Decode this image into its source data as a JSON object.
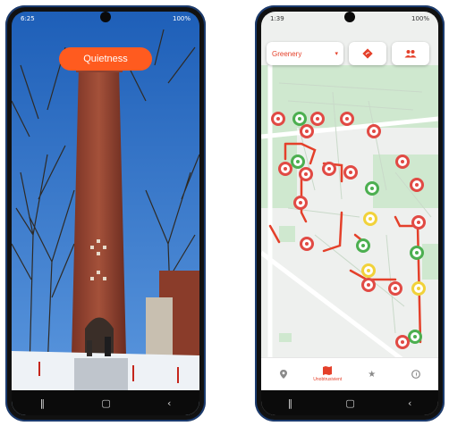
{
  "left_phone": {
    "status_time": "6:25",
    "status_right": "100%",
    "quietness_button": "Quietness"
  },
  "right_phone": {
    "status_time": "1:39",
    "status_right": "100%",
    "dropdown_value": "Greenery",
    "bottom_tabs": [
      {
        "icon": "location-pin-icon",
        "label": ""
      },
      {
        "icon": "map-icon",
        "label": "Unobtrusivient"
      },
      {
        "icon": "star-icon",
        "label": ""
      },
      {
        "icon": "compass-icon",
        "label": ""
      }
    ]
  },
  "colors": {
    "accent": "#ff5b1f",
    "marker_red": "#e14a44",
    "marker_green": "#4caf50",
    "marker_yellow": "#f1d23a",
    "route_red": "#e4402a",
    "park_green": "#cfe8cf"
  }
}
